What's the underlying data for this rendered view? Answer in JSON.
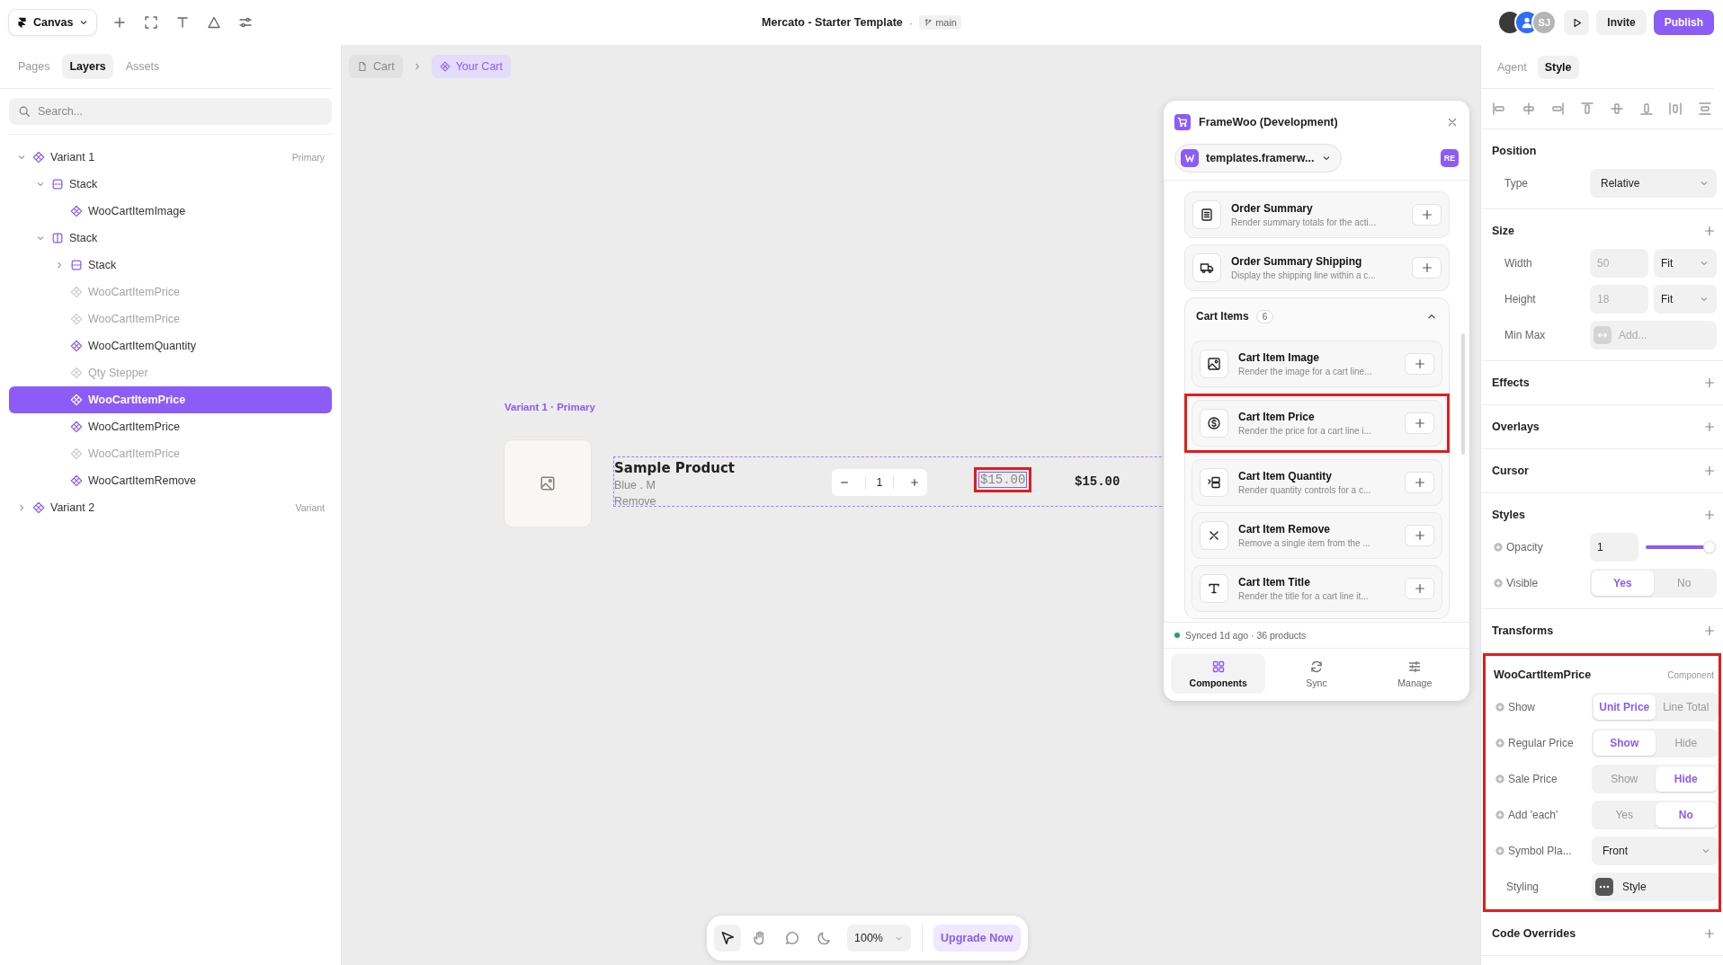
{
  "topbar": {
    "app_menu": "Canvas",
    "title": "Mercato - Starter Template",
    "separator": "·",
    "branch": "main",
    "avatar_initials": "SJ",
    "invite": "Invite",
    "publish": "Publish"
  },
  "layers_panel": {
    "tabs": [
      {
        "label": "Pages",
        "selected": false
      },
      {
        "label": "Layers",
        "selected": true
      },
      {
        "label": "Assets",
        "selected": false
      }
    ],
    "search": {
      "placeholder": "Search..."
    },
    "items": [
      {
        "name": "Variant 1",
        "kind": "component",
        "badge": "Primary",
        "expanded": true,
        "hidden": false,
        "selected": false,
        "children": [
          {
            "name": "Stack",
            "kind": "stack-rows",
            "expanded": true,
            "hidden": false,
            "selected": false,
            "children": [
              {
                "name": "WooCartItemImage",
                "kind": "component",
                "hidden": false,
                "selected": false
              }
            ]
          },
          {
            "name": "Stack",
            "kind": "stack-columns",
            "expanded": true,
            "hidden": false,
            "selected": false,
            "children": [
              {
                "name": "Stack",
                "kind": "stack-rows",
                "expanded": false,
                "hidden": false,
                "selected": false
              },
              {
                "name": "WooCartItemPrice",
                "kind": "component",
                "hidden": true,
                "selected": false
              },
              {
                "name": "WooCartItemPrice",
                "kind": "component",
                "hidden": true,
                "selected": false
              },
              {
                "name": "WooCartItemQuantity",
                "kind": "component",
                "hidden": false,
                "selected": false
              },
              {
                "name": "Qty Stepper",
                "kind": "component",
                "hidden": true,
                "selected": false
              },
              {
                "name": "WooCartItemPrice",
                "kind": "component",
                "hidden": false,
                "selected": true
              },
              {
                "name": "WooCartItemPrice",
                "kind": "component",
                "hidden": false,
                "selected": false
              },
              {
                "name": "WooCartItemPrice",
                "kind": "component",
                "hidden": true,
                "selected": false
              },
              {
                "name": "WooCartItemRemove",
                "kind": "component",
                "hidden": false,
                "selected": false
              }
            ]
          }
        ]
      },
      {
        "name": "Variant 2",
        "kind": "component",
        "badge": "Variant",
        "expanded": false,
        "hidden": false,
        "selected": false
      }
    ]
  },
  "canvas": {
    "breadcrumb": [
      {
        "label": "Cart",
        "selected": false
      },
      {
        "label": "Your Cart",
        "selected": true
      }
    ],
    "frame_label": "Variant 1 · Primary",
    "product": {
      "title": "Sample Product",
      "variant": "Blue . M",
      "remove": "Remove",
      "quantity": "1",
      "unit_price": "$15.00",
      "unit_price_highlighted": true,
      "line_total": "$15.00"
    }
  },
  "plugin": {
    "title": "FrameWoo (Development)",
    "site": "templates.framerw...",
    "user": "RE",
    "items": [
      {
        "title": "Order Summary",
        "description": "Render summary totals for the acti...",
        "highlighted": false
      },
      {
        "title": "Order Summary Shipping",
        "description": "Display the shipping line within a c...",
        "highlighted": false
      }
    ],
    "group": {
      "title": "Cart Items",
      "count": "6",
      "expanded": true,
      "items": [
        {
          "title": "Cart Item Image",
          "description": "Render the image for a cart line...",
          "highlighted": false
        },
        {
          "title": "Cart Item Price",
          "description": "Render the price for a cart line i...",
          "highlighted": true
        },
        {
          "title": "Cart Item Quantity",
          "description": "Render quantity controls for a c...",
          "highlighted": false
        },
        {
          "title": "Cart Item Remove",
          "description": "Remove a single item from the ...",
          "highlighted": false
        },
        {
          "title": "Cart Item Title",
          "description": "Render the title for a cart line it...",
          "highlighted": false
        }
      ]
    },
    "status": "Synced 1d ago · 36 products",
    "tabs": [
      {
        "label": "Components",
        "selected": true
      },
      {
        "label": "Sync",
        "selected": false
      },
      {
        "label": "Manage",
        "selected": false
      }
    ]
  },
  "style_panel": {
    "tabs": [
      {
        "label": "Agent",
        "selected": false
      },
      {
        "label": "Style",
        "selected": true
      }
    ],
    "sections": [
      {
        "title": "Position",
        "addable": false,
        "rows": [
          {
            "kind": "select",
            "label": "Type",
            "value": "Relative"
          }
        ]
      },
      {
        "title": "Size",
        "addable": true,
        "rows": [
          {
            "kind": "input-select",
            "label": "Width",
            "placeholder": "50",
            "option": "Fit"
          },
          {
            "kind": "input-select",
            "label": "Height",
            "placeholder": "18",
            "option": "Fit"
          },
          {
            "kind": "add-field",
            "label": "Min Max",
            "placeholder": "Add..."
          }
        ]
      },
      {
        "title": "Effects",
        "addable": true
      },
      {
        "title": "Overlays",
        "addable": true
      },
      {
        "title": "Cursor",
        "addable": true
      },
      {
        "title": "Styles",
        "addable": true,
        "rows": [
          {
            "kind": "slider",
            "label": "Opacity",
            "linkable": true,
            "value": "1",
            "level": 1
          },
          {
            "kind": "segmented",
            "label": "Visible",
            "linkable": true,
            "options": [
              {
                "label": "Yes",
                "selected": true
              },
              {
                "label": "No",
                "selected": false
              }
            ]
          }
        ]
      },
      {
        "title": "Transforms",
        "addable": true
      },
      {
        "title": "WooCartItemPrice",
        "tag": "Component",
        "addable": false,
        "highlighted": true,
        "rows": [
          {
            "kind": "segmented",
            "label": "Show",
            "linkable": true,
            "options": [
              {
                "label": "Unit Price",
                "selected": true
              },
              {
                "label": "Line Total",
                "selected": false
              }
            ]
          },
          {
            "kind": "segmented",
            "label": "Regular Price",
            "linkable": true,
            "options": [
              {
                "label": "Show",
                "selected": true
              },
              {
                "label": "Hide",
                "selected": false
              }
            ]
          },
          {
            "kind": "segmented",
            "label": "Sale Price",
            "linkable": true,
            "options": [
              {
                "label": "Show",
                "selected": false
              },
              {
                "label": "Hide",
                "selected": true
              }
            ]
          },
          {
            "kind": "segmented",
            "label": "Add 'each'",
            "linkable": true,
            "options": [
              {
                "label": "Yes",
                "selected": false
              },
              {
                "label": "No",
                "selected": true
              }
            ]
          },
          {
            "kind": "select",
            "label": "Symbol Pla...",
            "linkable": true,
            "value": "Front"
          },
          {
            "kind": "style",
            "label": "Styling",
            "linkable": false,
            "value": "Style"
          }
        ]
      },
      {
        "title": "Code Overrides",
        "addable": true
      }
    ]
  },
  "toolbar": {
    "tools": [
      {
        "selected": true
      },
      {
        "selected": false
      },
      {
        "selected": false
      },
      {
        "selected": false
      }
    ],
    "zoom": "100%",
    "upgrade": "Upgrade Now"
  }
}
